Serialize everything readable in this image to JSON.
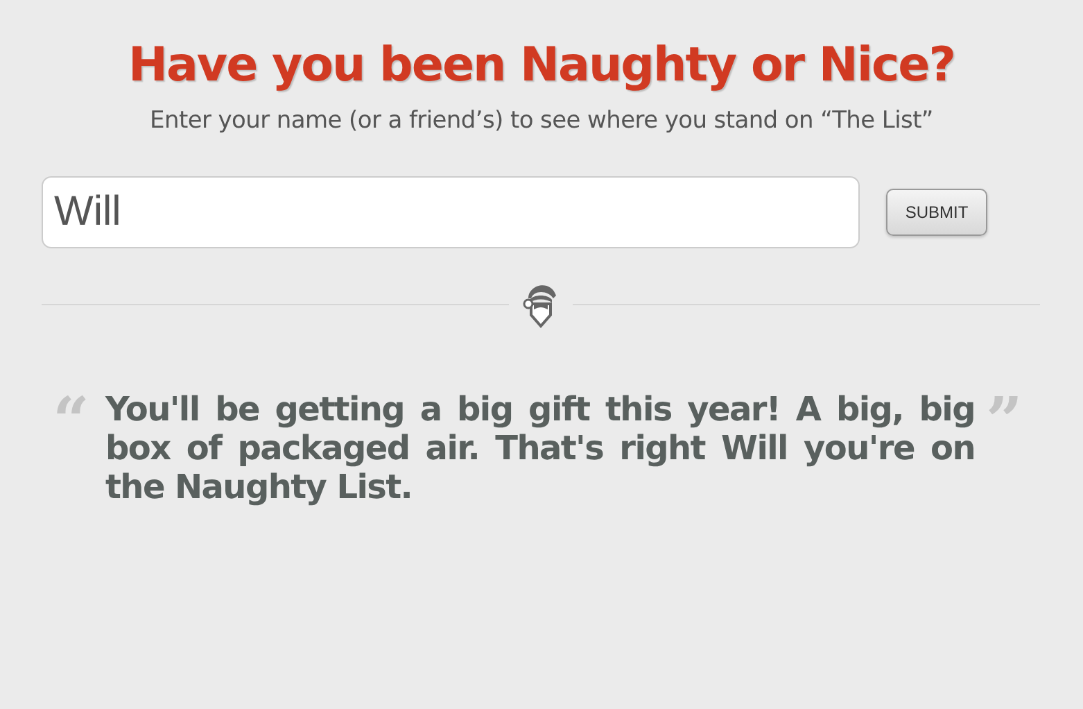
{
  "heading": "Have you been Naughty or Nice?",
  "subheading": "Enter your name (or a friend’s) to see where you stand on “The List”",
  "name_field": {
    "value": "Will"
  },
  "submit_button": "SUBMIT",
  "result": {
    "open_mark": "“",
    "text": "You'll be getting a big gift this year! A big, big box of packaged air. That's right Will you're on the Naughty List.",
    "close_mark": "”"
  }
}
